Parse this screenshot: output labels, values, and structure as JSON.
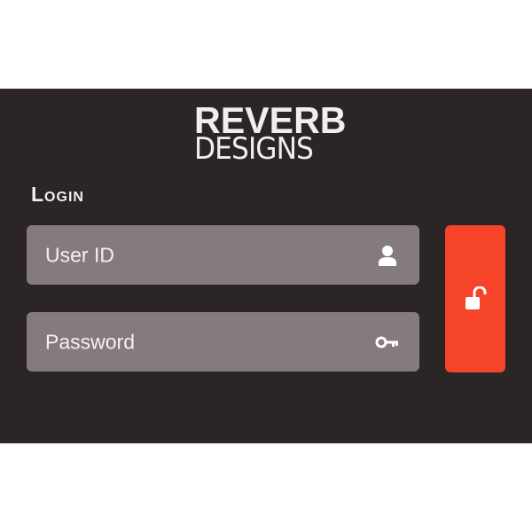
{
  "logo": {
    "line1": "REVERB",
    "line2": "DESIGNS"
  },
  "login": {
    "title": "Login",
    "user_placeholder": "User ID",
    "password_placeholder": "Password"
  },
  "icons": {
    "user": "user-icon",
    "password": "key-icon",
    "submit": "unlock-icon"
  },
  "colors": {
    "panel_bg": "#2b2526",
    "field_bg": "#857b7f",
    "accent": "#f5442a",
    "text": "#f2eeee"
  }
}
